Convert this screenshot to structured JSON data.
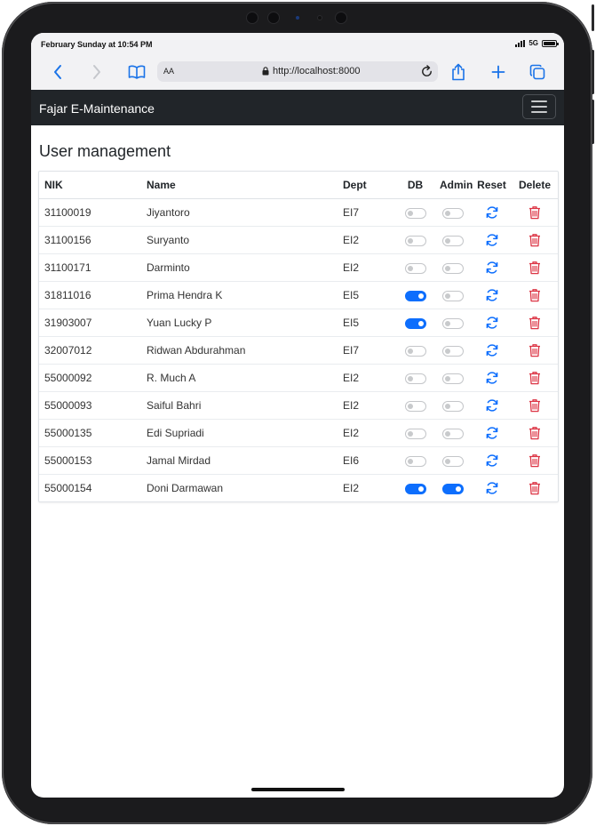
{
  "status": {
    "time": "February Sunday at 10:54 PM",
    "network": "5G"
  },
  "browser": {
    "text_size_label": "AA",
    "url": "http://localhost:8000"
  },
  "navbar": {
    "brand": "Fajar E-Maintenance"
  },
  "page": {
    "title": "User management"
  },
  "table": {
    "headers": {
      "nik": "NIK",
      "name": "Name",
      "dept": "Dept",
      "db": "DB",
      "admin": "Admin",
      "reset": "Reset",
      "delete": "Delete"
    },
    "rows": [
      {
        "nik": "31100019",
        "name": "Jiyantoro",
        "dept": "EI7",
        "db": false,
        "admin": false
      },
      {
        "nik": "31100156",
        "name": "Suryanto",
        "dept": "EI2",
        "db": false,
        "admin": false
      },
      {
        "nik": "31100171",
        "name": "Darminto",
        "dept": "EI2",
        "db": false,
        "admin": false
      },
      {
        "nik": "31811016",
        "name": "Prima Hendra K",
        "dept": "EI5",
        "db": true,
        "admin": false
      },
      {
        "nik": "31903007",
        "name": "Yuan Lucky P",
        "dept": "EI5",
        "db": true,
        "admin": false
      },
      {
        "nik": "32007012",
        "name": "Ridwan Abdurahman",
        "dept": "EI7",
        "db": false,
        "admin": false
      },
      {
        "nik": "55000092",
        "name": "R. Much A",
        "dept": "EI2",
        "db": false,
        "admin": false
      },
      {
        "nik": "55000093",
        "name": "Saiful Bahri",
        "dept": "EI2",
        "db": false,
        "admin": false
      },
      {
        "nik": "55000135",
        "name": "Edi Supriadi",
        "dept": "EI2",
        "db": false,
        "admin": false
      },
      {
        "nik": "55000153",
        "name": "Jamal Mirdad",
        "dept": "EI6",
        "db": false,
        "admin": false
      },
      {
        "nik": "55000154",
        "name": "Doni Darmawan",
        "dept": "EI2",
        "db": true,
        "admin": true
      }
    ]
  },
  "icons": {
    "back": "chevron-left-icon",
    "forward": "chevron-right-icon",
    "bookmarks": "book-icon",
    "lock": "lock-icon",
    "reload": "reload-icon",
    "share": "share-icon",
    "new_tab": "plus-icon",
    "tabs": "tabs-icon",
    "menu": "hamburger-icon",
    "reset": "refresh-icon",
    "delete": "trash-icon"
  },
  "colors": {
    "accent": "#0d6efd",
    "danger": "#dc3545",
    "navbar": "#212529",
    "browser_chrome": "#f2f2f4"
  }
}
